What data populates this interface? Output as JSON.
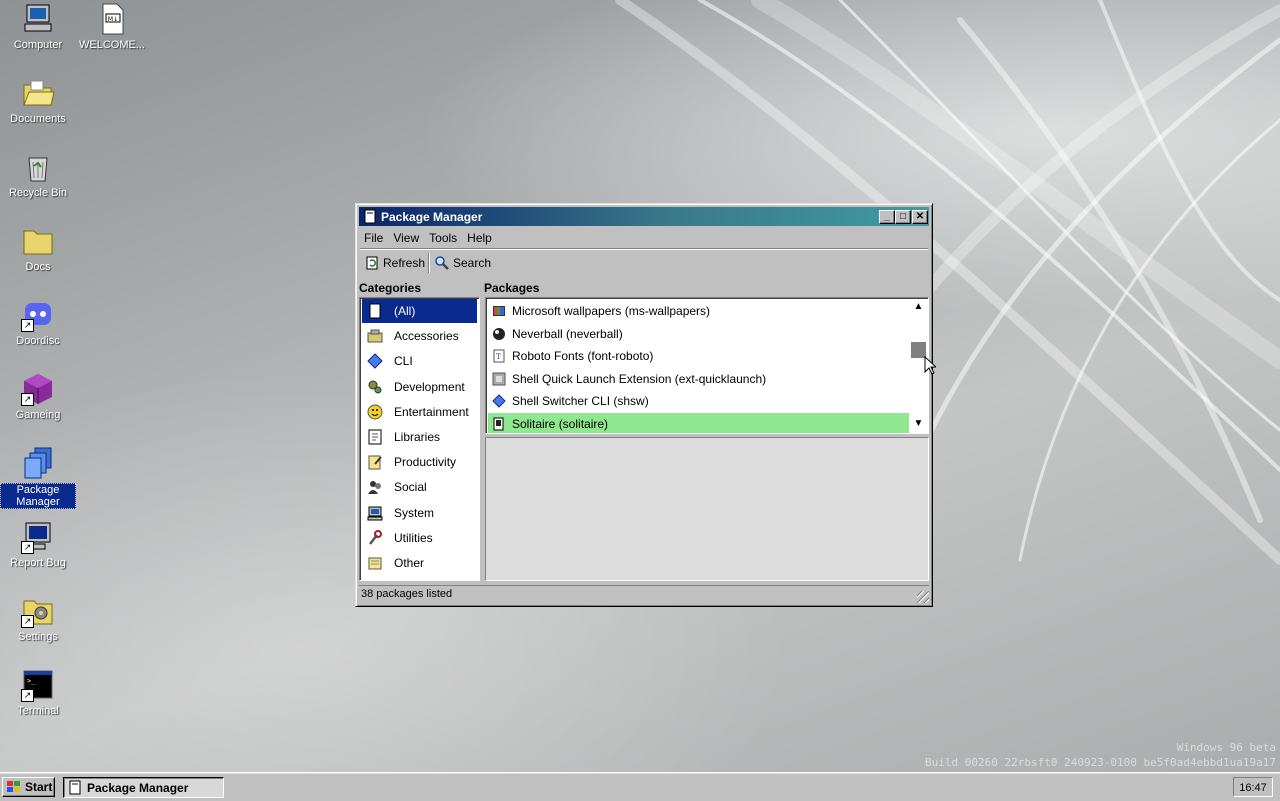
{
  "desktop": {
    "icons": [
      {
        "label": "Computer"
      },
      {
        "label": "WELCOME..."
      },
      {
        "label": "Documents"
      },
      {
        "label": "Recycle Bin"
      },
      {
        "label": "Docs"
      },
      {
        "label": "Doordisc"
      },
      {
        "label": "Gameing"
      },
      {
        "label": "Package\nManager"
      },
      {
        "label": "Report Bug"
      },
      {
        "label": "Settings"
      },
      {
        "label": "Terminal"
      }
    ],
    "watermark_line1": "Windows 96 beta",
    "watermark_line2": "Build 00260 22rbsft0 240923-0100 be5f0ad4ebbd1ua19a17"
  },
  "window": {
    "title": "Package Manager",
    "buttons": {
      "minimize": "_",
      "maximize": "□",
      "close": "✕"
    },
    "menu": [
      "File",
      "View",
      "Tools",
      "Help"
    ],
    "toolbar": {
      "refresh": "Refresh",
      "search": "Search"
    },
    "categories_header": "Categories",
    "packages_header": "Packages",
    "categories": [
      {
        "label": "(All)",
        "icon": "all-icon",
        "selected": true
      },
      {
        "label": "Accessories",
        "icon": "accessories-icon"
      },
      {
        "label": "CLI",
        "icon": "cli-icon"
      },
      {
        "label": "Development",
        "icon": "development-icon"
      },
      {
        "label": "Entertainment",
        "icon": "entertainment-icon"
      },
      {
        "label": "Libraries",
        "icon": "libraries-icon"
      },
      {
        "label": "Productivity",
        "icon": "productivity-icon"
      },
      {
        "label": "Social",
        "icon": "social-icon"
      },
      {
        "label": "System",
        "icon": "system-icon"
      },
      {
        "label": "Utilities",
        "icon": "utilities-icon"
      },
      {
        "label": "Other",
        "icon": "other-icon"
      }
    ],
    "packages": [
      {
        "label": "Microsoft wallpapers (ms-wallpapers)",
        "icon": "wallpaper-icon"
      },
      {
        "label": "Neverball (neverball)",
        "icon": "ball-icon"
      },
      {
        "label": "Roboto Fonts (font-roboto)",
        "icon": "font-icon"
      },
      {
        "label": "Shell Quick Launch Extension (ext-quicklaunch)",
        "icon": "extension-icon"
      },
      {
        "label": "Shell Switcher CLI (shsw)",
        "icon": "cli-icon"
      },
      {
        "label": "Solitaire (solitaire)",
        "icon": "cards-icon",
        "highlighted": true
      }
    ],
    "status": "38 packages listed",
    "accent_title": "#0a246a",
    "accent_highlight": "#8fe88f"
  },
  "taskbar": {
    "start_label": "Start",
    "task_label": "Package Manager",
    "clock": "16:47"
  }
}
